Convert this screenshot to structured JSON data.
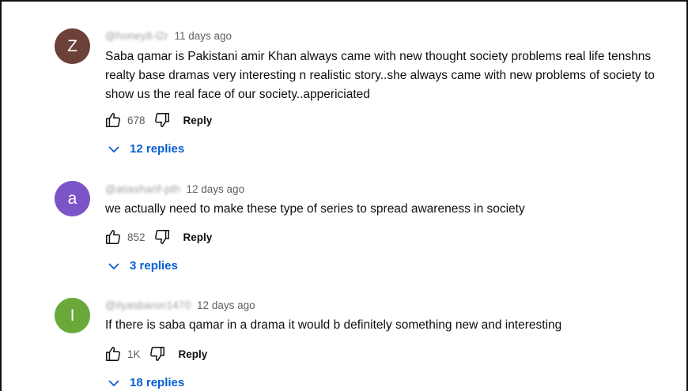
{
  "colors": {
    "avatar_z": "#6b4138",
    "avatar_a": "#7b55c7",
    "avatar_i": "#6aa83a",
    "link": "#065fd4"
  },
  "comments": [
    {
      "avatar_letter": "Z",
      "handle": "@honey8-l2r",
      "time": "11 days ago",
      "text": "Saba qamar is Pakistani amir Khan always came with new thought society problems real life tenshns realty base dramas very interesting n realistic story..she always came with new problems of society to show us the real face of our society..appericiated",
      "likes": "678",
      "reply_label": "Reply",
      "replies_label": "12 replies"
    },
    {
      "avatar_letter": "a",
      "handle": "@atiasharif-pth",
      "time": "12 days ago",
      "text": "we actually need to make these type of series to spread awareness in society",
      "likes": "852",
      "reply_label": "Reply",
      "replies_label": "3 replies"
    },
    {
      "avatar_letter": "I",
      "handle": "@ilyasbaron1470",
      "time": "12 days ago",
      "text": "If there is saba qamar in a drama it would b definitely something new and interesting",
      "likes": "1K",
      "reply_label": "Reply",
      "replies_label": "18 replies"
    }
  ]
}
